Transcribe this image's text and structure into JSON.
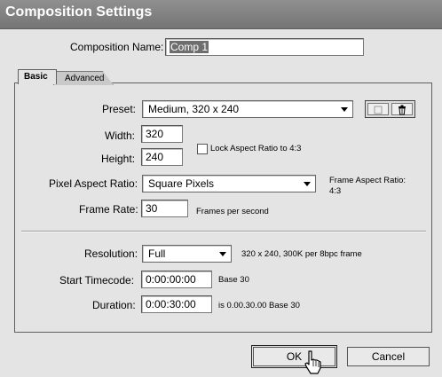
{
  "window": {
    "title": "Composition Settings"
  },
  "comp_name": {
    "label": "Composition Name:",
    "value": "Comp 1"
  },
  "tabs": [
    {
      "label": "Basic"
    },
    {
      "label": "Advanced"
    }
  ],
  "basic": {
    "preset": {
      "label": "Preset:",
      "value": "Medium, 320 x 240"
    },
    "width": {
      "label": "Width:",
      "value": "320"
    },
    "height": {
      "label": "Height:",
      "value": "240"
    },
    "lock_aspect": {
      "label": "Lock Aspect Ratio to 4:3",
      "checked": false
    },
    "pixel_aspect": {
      "label": "Pixel Aspect Ratio:",
      "value": "Square Pixels"
    },
    "frame_aspect": {
      "label": "Frame Aspect Ratio:",
      "value": "4:3"
    },
    "frame_rate": {
      "label": "Frame Rate:",
      "value": "30",
      "unit": "Frames per second"
    },
    "resolution": {
      "label": "Resolution:",
      "value": "Full",
      "info": "320 x 240, 300K per 8bpc frame"
    },
    "start_timecode": {
      "label": "Start Timecode:",
      "value": "0:00:00:00",
      "base": "Base 30"
    },
    "duration": {
      "label": "Duration:",
      "value": "0:00:30:00",
      "info": "is 0.00.30.00  Base 30"
    }
  },
  "buttons": {
    "ok": "OK",
    "cancel": "Cancel"
  },
  "icons": {
    "save_preset": "save-preset-icon",
    "delete_preset": "trash-icon"
  }
}
